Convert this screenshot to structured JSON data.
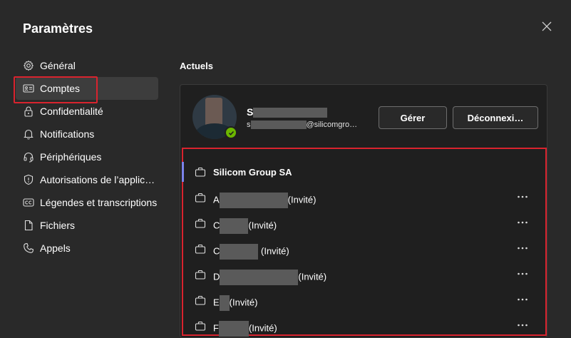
{
  "window": {
    "title": "Paramètres"
  },
  "nav": {
    "items": [
      {
        "id": "general",
        "label": "Général",
        "icon": "gear-icon"
      },
      {
        "id": "accounts",
        "label": "Comptes",
        "icon": "id-card-icon",
        "active": true
      },
      {
        "id": "privacy",
        "label": "Confidentialité",
        "icon": "lock-icon"
      },
      {
        "id": "notifications",
        "label": "Notifications",
        "icon": "bell-icon"
      },
      {
        "id": "devices",
        "label": "Périphériques",
        "icon": "headset-icon"
      },
      {
        "id": "permissions",
        "label": "Autorisations de l’applic…",
        "icon": "shield-icon"
      },
      {
        "id": "captions",
        "label": "Légendes et transcriptions",
        "icon": "cc-icon"
      },
      {
        "id": "files",
        "label": "Fichiers",
        "icon": "file-icon"
      },
      {
        "id": "calls",
        "label": "Appels",
        "icon": "phone-icon"
      }
    ]
  },
  "main": {
    "section_title": "Actuels",
    "profile": {
      "name_prefix": "S",
      "email_prefix": "s",
      "email_suffix": "@silicomgro…",
      "presence": "available"
    },
    "buttons": {
      "manage": "Gérer",
      "logout": "Déconnexi…"
    },
    "tenants": [
      {
        "name": "Silicom Group SA",
        "suffix": "",
        "current": true
      },
      {
        "name": "A",
        "suffix": "(Invité)"
      },
      {
        "name": "C",
        "suffix": "(Invité)"
      },
      {
        "name": "C",
        "suffix": "(Invité)"
      },
      {
        "name": "D",
        "suffix": "(Invité)"
      },
      {
        "name": "E",
        "suffix": "(Invité)"
      },
      {
        "name": "F",
        "suffix": "(Invité)"
      }
    ]
  },
  "colors": {
    "background": "#292929",
    "card": "#1f1f1f",
    "highlight": "#d9232e",
    "accent": "#7b83eb",
    "presence": "#6bb700"
  }
}
